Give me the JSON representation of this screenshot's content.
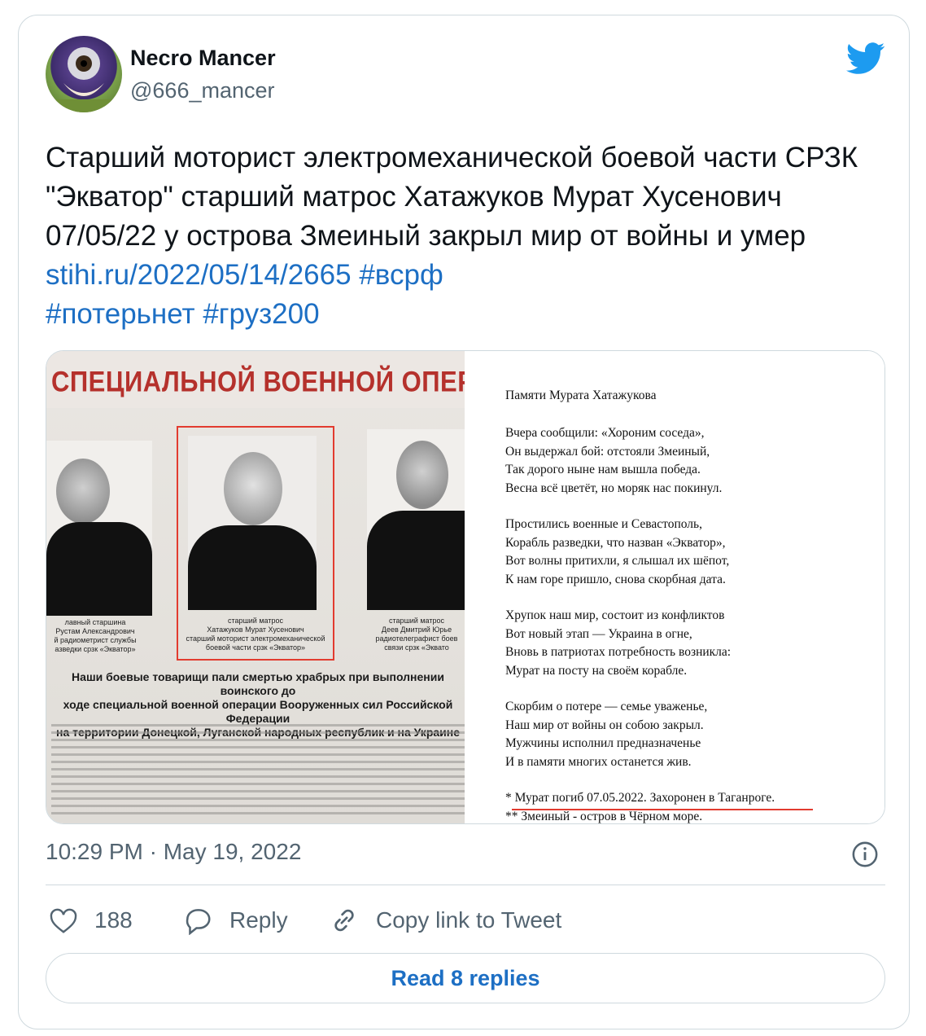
{
  "user": {
    "name": "Necro Mancer",
    "handle": "@666_mancer"
  },
  "tweet": {
    "text_plain": "Старший моторист электромеханической боевой части СРЗК \"Экватор\" старший матрос Хатажуков Мурат Хусенович 07/05/22 у острова Змеиный закрыл мир от войны и умер ",
    "link": "stihi.ru/2022/05/14/2665",
    "hashtags": [
      "#всрф",
      "#потерьнет",
      "#груз200"
    ]
  },
  "media": {
    "banner": "СПЕЦИАЛЬНОЙ ВОЕННОЙ ОПЕР",
    "left_caption": [
      "лавный старшина",
      "Рустам Александрович",
      "й радиометрист службы",
      "азведки срзк «Экватор»"
    ],
    "center_caption": [
      "старший матрос",
      "Хатажуков Мурат Хусенович",
      "старший моторист электромеханической",
      "боевой части срзк «Экватор»"
    ],
    "right_caption": [
      "старший матрос",
      "Деев Дмитрий Юрье",
      "радиотелеграфист боев",
      "связи срзк «Эквато"
    ],
    "bold_caption": [
      "Наши боевые товарищи пали смертью храбрых при выполнении воинского до",
      "ходе специальной военной операции Вооруженных сил Российской Федерации",
      "на территории Донецкой, Луганской народных республик и на Украине"
    ],
    "poem": [
      "Памяти Мурата Хатажукова",
      "",
      "Вчера сообщили: «Хороним соседа»,",
      "Он выдержал бой: отстояли Змеиный,",
      "Так дорого ныне нам вышла победа.",
      "Весна всё цветёт, но моряк нас покинул.",
      "",
      "Простились военные и Севастополь,",
      "Корабль разведки, что назван «Экватор»,",
      "Вот волны притихли, я слышал их шёпот,",
      "К нам горе пришло, снова скорбная дата.",
      "",
      "Хрупок наш мир, состоит из конфликтов",
      "Вот новый этап — Украина в огне,",
      "Вновь в патриотах потребность возникла:",
      "Мурат на посту на своём корабле.",
      "",
      "Скорбим о потере — семье уваженье,",
      "Наш мир от войны он собою закрыл.",
      "Мужчины исполнил предназначенье",
      "И в памяти многих останется жив.",
      "",
      "* Мурат погиб 07.05.2022. Захоронен в Таганроге.",
      "** Змеиный - остров в Чёрном море."
    ]
  },
  "timestamp": "10:29 PM · May 19, 2022",
  "actions": {
    "likes": "188",
    "reply": "Reply",
    "copy": "Copy link to Tweet"
  },
  "read_replies": "Read 8 replies",
  "colors": {
    "link": "#1d6fc4",
    "twitter_blue": "#1d9bf0",
    "muted": "#536471",
    "red_mark": "#e23b2f"
  }
}
